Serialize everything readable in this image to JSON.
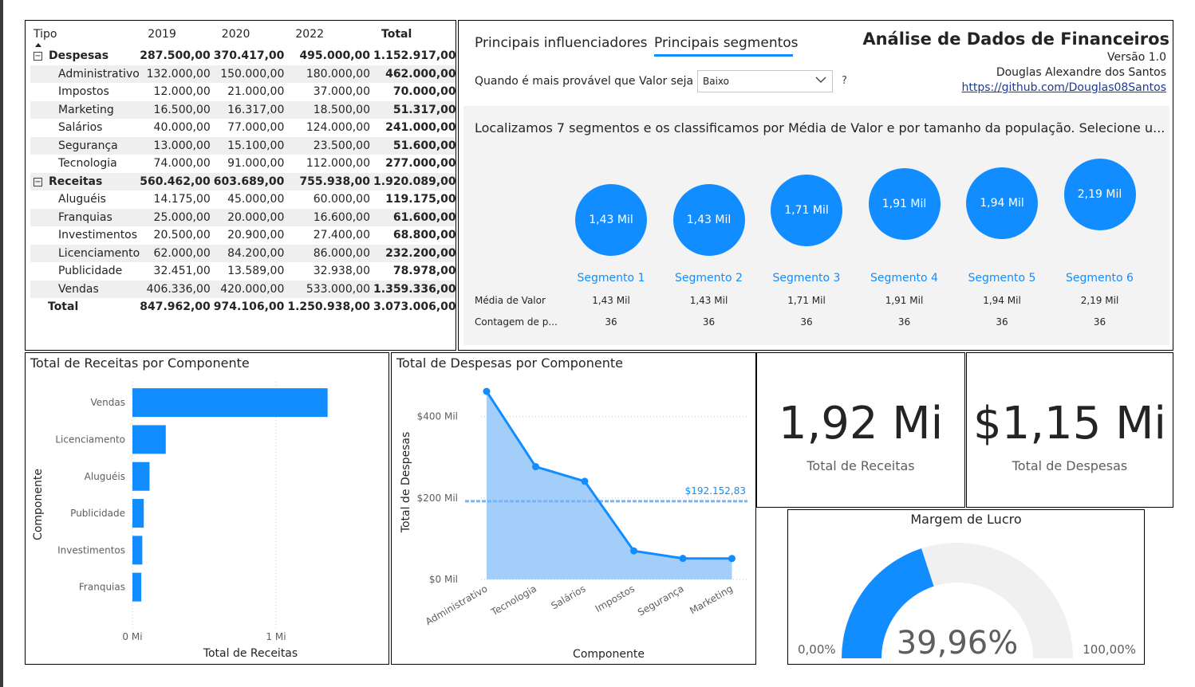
{
  "matrix": {
    "headers": [
      "Tipo",
      "2019",
      "2020",
      "2022",
      "Total"
    ],
    "groups": [
      {
        "label": "Despesas",
        "values": [
          "287.500,00",
          "370.417,00",
          "495.000,00",
          "1.152.917,00"
        ],
        "rows": [
          {
            "label": "Administrativo",
            "values": [
              "132.000,00",
              "150.000,00",
              "180.000,00",
              "462.000,00"
            ]
          },
          {
            "label": "Impostos",
            "values": [
              "12.000,00",
              "21.000,00",
              "37.000,00",
              "70.000,00"
            ]
          },
          {
            "label": "Marketing",
            "values": [
              "16.500,00",
              "16.317,00",
              "18.500,00",
              "51.317,00"
            ]
          },
          {
            "label": "Salários",
            "values": [
              "40.000,00",
              "77.000,00",
              "124.000,00",
              "241.000,00"
            ]
          },
          {
            "label": "Segurança",
            "values": [
              "13.000,00",
              "15.100,00",
              "23.500,00",
              "51.600,00"
            ]
          },
          {
            "label": "Tecnologia",
            "values": [
              "74.000,00",
              "91.000,00",
              "112.000,00",
              "277.000,00"
            ]
          }
        ]
      },
      {
        "label": "Receitas",
        "values": [
          "560.462,00",
          "603.689,00",
          "755.938,00",
          "1.920.089,00"
        ],
        "rows": [
          {
            "label": "Aluguéis",
            "values": [
              "14.175,00",
              "45.000,00",
              "60.000,00",
              "119.175,00"
            ]
          },
          {
            "label": "Franquias",
            "values": [
              "25.000,00",
              "20.000,00",
              "16.600,00",
              "61.600,00"
            ]
          },
          {
            "label": "Investimentos",
            "values": [
              "20.500,00",
              "20.900,00",
              "27.400,00",
              "68.800,00"
            ]
          },
          {
            "label": "Licenciamento",
            "values": [
              "62.000,00",
              "84.200,00",
              "86.000,00",
              "232.200,00"
            ]
          },
          {
            "label": "Publicidade",
            "values": [
              "32.451,00",
              "13.589,00",
              "32.938,00",
              "78.978,00"
            ]
          },
          {
            "label": "Vendas",
            "values": [
              "406.336,00",
              "420.000,00",
              "533.000,00",
              "1.359.336,00"
            ]
          }
        ]
      }
    ],
    "total": {
      "label": "Total",
      "values": [
        "847.962,00",
        "974.106,00",
        "1.250.938,00",
        "3.073.006,00"
      ]
    }
  },
  "segments_panel": {
    "tabs": [
      "Principais influenciadores",
      "Principais segmentos"
    ],
    "active_tab": 1,
    "title": "Análise de Dados de Financeiros",
    "version": "Versão 1.0",
    "author": "Douglas Alexandre dos Santos",
    "link": "https://github.com/Douglas08Santos",
    "question": "Quando é mais provável que Valor seja",
    "select_value": "Baixo",
    "help": "?",
    "summary": "Localizamos 7 segmentos e os classificamos por Média de Valor e por tamanho da população. Selecione u...",
    "row_labels": [
      "Média de Valor",
      "Contagem de p..."
    ],
    "segments": [
      {
        "name": "Segmento 1",
        "value_label": "1,43 Mil",
        "value": 1.43,
        "count": "36"
      },
      {
        "name": "Segmento 2",
        "value_label": "1,43 Mil",
        "value": 1.43,
        "count": "36"
      },
      {
        "name": "Segmento 3",
        "value_label": "1,71 Mil",
        "value": 1.71,
        "count": "36"
      },
      {
        "name": "Segmento 4",
        "value_label": "1,91 Mil",
        "value": 1.91,
        "count": "36"
      },
      {
        "name": "Segmento 5",
        "value_label": "1,94 Mil",
        "value": 1.94,
        "count": "36"
      },
      {
        "name": "Segmento 6",
        "value_label": "2,19 Mil",
        "value": 2.19,
        "count": "36"
      }
    ]
  },
  "chart_data": [
    {
      "type": "bar",
      "orientation": "horizontal",
      "title": "Total de Receitas por Componente",
      "xlabel": "Total de Receitas",
      "ylabel": "Componente",
      "categories": [
        "Vendas",
        "Licenciamento",
        "Aluguéis",
        "Publicidade",
        "Investimentos",
        "Franquias"
      ],
      "values": [
        1359336,
        232200,
        119175,
        78978,
        68800,
        61600
      ],
      "xlim": [
        0,
        1500000
      ],
      "x_ticks": [
        {
          "value": 0,
          "label": "0 Mi"
        },
        {
          "value": 1000000,
          "label": "1 Mi"
        }
      ],
      "color": "#118dff"
    },
    {
      "type": "area",
      "title": "Total de Despesas por Componente",
      "xlabel": "Componente",
      "ylabel": "Total de Despesas",
      "categories": [
        "Administrativo",
        "Tecnologia",
        "Salários",
        "Impostos",
        "Segurança",
        "Marketing"
      ],
      "values": [
        462000,
        277000,
        241000,
        70000,
        51600,
        51317
      ],
      "ylim": [
        0,
        470000
      ],
      "y_ticks": [
        {
          "value": 0,
          "label": "$0 Mil"
        },
        {
          "value": 200000,
          "label": "$200 Mil"
        },
        {
          "value": 400000,
          "label": "$400 Mil"
        }
      ],
      "average_line": {
        "value": 192152.83,
        "label": "$192.152,83"
      },
      "color": "#118dff",
      "fill": "#9ecbf9"
    },
    {
      "type": "gauge",
      "title": "Margem de Lucro",
      "value": 39.96,
      "value_label": "39,96%",
      "min_label": "0,00%",
      "max_label": "100,00%",
      "min": 0,
      "max": 100,
      "color": "#118dff",
      "track_color": "#f0f0f0"
    }
  ],
  "cards": {
    "receitas": {
      "value": "1,92 Mi",
      "label": "Total de Receitas"
    },
    "despesas": {
      "value": "$1,15 Mi",
      "label": "Total de Despesas"
    }
  }
}
